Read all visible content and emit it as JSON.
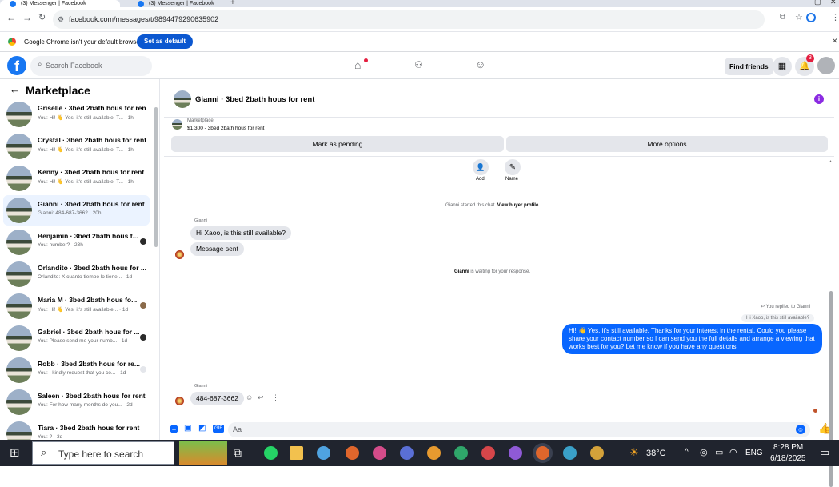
{
  "browser": {
    "tabs": [
      {
        "title": "(3) Messenger | Facebook",
        "active": true
      },
      {
        "title": "(3) Messenger | Facebook",
        "active": false
      }
    ],
    "url": "facebook.com/messages/t/9894479290635902",
    "infobar_text": "Google Chrome isn't your default browser",
    "set_default_label": "Set as default"
  },
  "fb": {
    "search_placeholder": "Search Facebook",
    "find_friends": "Find friends",
    "notif_count": "3"
  },
  "sidebar": {
    "title": "Marketplace",
    "conversations": [
      {
        "name": "Griselle · 3bed 2bath hous for rent",
        "preview": "You: Hi! 👋 Yes, it's still available. T... · 1h"
      },
      {
        "name": "Crystal · 3bed 2bath hous for rent",
        "preview": "You: Hi! 👋 Yes, it's still available. T... · 1h"
      },
      {
        "name": "Kenny · 3bed 2bath hous for rent",
        "preview": "You: Hi! 👋 Yes, it's still available. T... · 1h"
      },
      {
        "name": "Gianni · 3bed 2bath hous for rent",
        "preview": "Gianni: 484-687-3662 · 20h"
      },
      {
        "name": "Benjamin · 3bed 2bath hous f...",
        "preview": "You: number? · 23h"
      },
      {
        "name": "Orlandito · 3bed 2bath hous for ...",
        "preview": "Orlandito: X cuanto tiempo lo tiene... · 1d"
      },
      {
        "name": "Maria M · 3bed 2bath hous fo...",
        "preview": "You: Hi! 👋 Yes, it's still available... · 1d"
      },
      {
        "name": "Gabriel · 3bed 2bath hous for ...",
        "preview": "You: Please send me your numb... · 1d"
      },
      {
        "name": "Robb · 3bed 2bath hous for re...",
        "preview": "You: I kindly request that you co... · 1d"
      },
      {
        "name": "Saleen · 3bed 2bath hous for rent",
        "preview": "You: For how many months do you... · 2d"
      },
      {
        "name": "Tiara · 3bed 2bath hous for rent",
        "preview": "You: ? · 3d"
      }
    ]
  },
  "chat": {
    "title": "Gianni · 3bed 2bath hous for rent",
    "listing_source": "Marketplace",
    "listing_line": "$1,300 - 3bed 2bath hous for rent",
    "mark_pending": "Mark as pending",
    "more_options": "More options",
    "add_label": "Add",
    "name_label": "Name",
    "started_text": "Gianni started this chat.",
    "view_profile": "View buyer profile",
    "sender1": "Gianni",
    "msg1": "Hi Xaoo, is this still available?",
    "msg2": "Message sent",
    "waiting_name": "Gianni",
    "waiting_text": "is waiting for your response.",
    "replied_to": "You replied to Gianni",
    "quoted": "Hi Xaoo, is this still available?",
    "reply": "Hi! 👋 Yes, it's still available. Thanks for your interest in the rental. Could you please share your contact number so I can send you the full details and arrange a viewing that works best for you? Let me know if you have any questions",
    "sender2": "Gianni",
    "msg3": "484-687-3662",
    "input_placeholder": "Aa"
  },
  "taskbar": {
    "search_placeholder": "Type here to search",
    "temperature": "38°C",
    "lang": "ENG",
    "time": "8:28 PM",
    "date": "6/18/2025"
  },
  "colors": {
    "fb_blue": "#0866ff",
    "brand": "#1877f2",
    "notif_red": "#e41e3f"
  }
}
